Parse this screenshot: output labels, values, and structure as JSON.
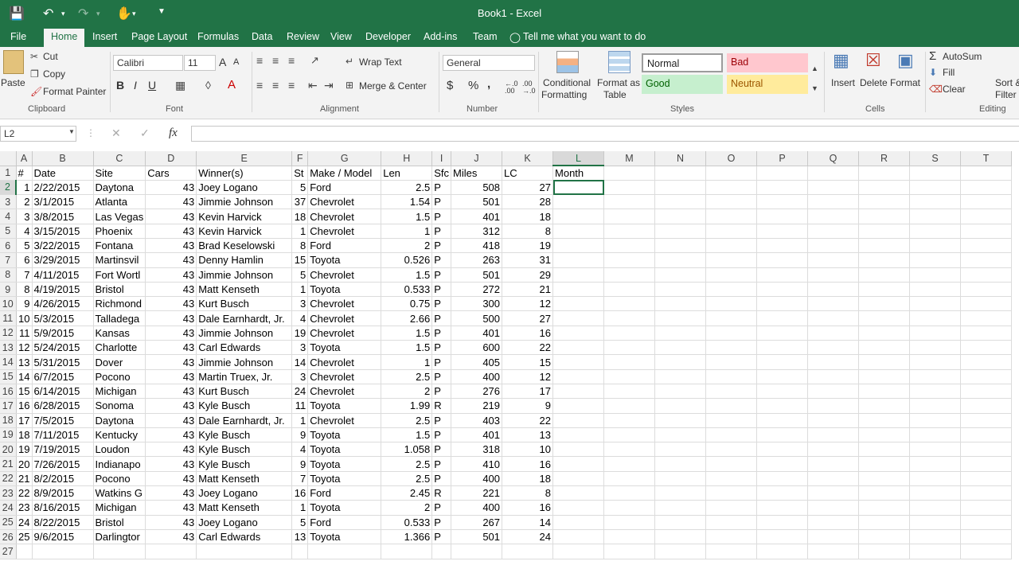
{
  "window": {
    "title": "Book1 - Excel"
  },
  "tabs": [
    "File",
    "Home",
    "Insert",
    "Page Layout",
    "Formulas",
    "Data",
    "Review",
    "View",
    "Developer",
    "Add-ins",
    "Team"
  ],
  "tell_me": "Tell me what you want to do",
  "ribbon": {
    "clipboard": {
      "paste": "Paste",
      "cut": "Cut",
      "copy": "Copy",
      "format_painter": "Format Painter",
      "label": "Clipboard"
    },
    "font": {
      "family": "Calibri",
      "size": "11",
      "label": "Font",
      "bold": "B",
      "italic": "I",
      "underline": "U",
      "grow": "A",
      "shrink": "A"
    },
    "alignment": {
      "wrap": "Wrap Text",
      "merge": "Merge & Center",
      "label": "Alignment"
    },
    "number": {
      "format": "General",
      "currency": "$",
      "percent": "%",
      "comma": ",",
      "label": "Number",
      "inc_dec": "←.0 .00",
      "dec_dec": ".00 →.0"
    },
    "styles": {
      "conditional_1": "Conditional",
      "conditional_2": "Formatting",
      "format_as_1": "Format as",
      "format_as_2": "Table",
      "normal": "Normal",
      "bad": "Bad",
      "good": "Good",
      "neutral": "Neutral",
      "label": "Styles",
      "colors": {
        "normal_bg": "#ffffff",
        "bad_bg": "#ffc7ce",
        "bad_fg": "#9c0006",
        "good_bg": "#c6efce",
        "good_fg": "#006100",
        "neutral_bg": "#ffeb9c",
        "neutral_fg": "#9c5700"
      }
    },
    "cells": {
      "insert": "Insert",
      "delete": "Delete",
      "format": "Format",
      "label": "Cells"
    },
    "editing": {
      "autosum": "AutoSum",
      "fill": "Fill",
      "clear": "Clear",
      "sort_1": "Sort &",
      "sort_2": "Filter",
      "label": "Editing"
    }
  },
  "formula_bar": {
    "name_box": "L2",
    "fx": "fx",
    "value": ""
  },
  "accent": "#217346",
  "columns": [
    "A",
    "B",
    "C",
    "D",
    "E",
    "F",
    "G",
    "H",
    "I",
    "J",
    "K",
    "L",
    "M",
    "N",
    "O",
    "P",
    "Q",
    "R",
    "S",
    "T"
  ],
  "headers": [
    "#",
    "Date",
    "Site",
    "Cars",
    "Winner(s)",
    "St",
    "Make / Model",
    "Len",
    "Sfc",
    "Miles",
    "LC",
    "Month"
  ],
  "rows": [
    [
      "1",
      "2/22/2015",
      "Daytona",
      "43",
      "Joey Logano",
      "5",
      "Ford",
      "2.5",
      "P",
      "508",
      "27"
    ],
    [
      "2",
      "3/1/2015",
      "Atlanta",
      "43",
      "Jimmie Johnson",
      "37",
      "Chevrolet",
      "1.54",
      "P",
      "501",
      "28"
    ],
    [
      "3",
      "3/8/2015",
      "Las Vegas",
      "43",
      "Kevin Harvick",
      "18",
      "Chevrolet",
      "1.5",
      "P",
      "401",
      "18"
    ],
    [
      "4",
      "3/15/2015",
      "Phoenix",
      "43",
      "Kevin Harvick",
      "1",
      "Chevrolet",
      "1",
      "P",
      "312",
      "8"
    ],
    [
      "5",
      "3/22/2015",
      "Fontana",
      "43",
      "Brad Keselowski",
      "8",
      "Ford",
      "2",
      "P",
      "418",
      "19"
    ],
    [
      "6",
      "3/29/2015",
      "Martinsvil",
      "43",
      "Denny Hamlin",
      "15",
      "Toyota",
      "0.526",
      "P",
      "263",
      "31"
    ],
    [
      "7",
      "4/11/2015",
      "Fort Wortl",
      "43",
      "Jimmie Johnson",
      "5",
      "Chevrolet",
      "1.5",
      "P",
      "501",
      "29"
    ],
    [
      "8",
      "4/19/2015",
      "Bristol",
      "43",
      "Matt Kenseth",
      "1",
      "Toyota",
      "0.533",
      "P",
      "272",
      "21"
    ],
    [
      "9",
      "4/26/2015",
      "Richmond",
      "43",
      "Kurt Busch",
      "3",
      "Chevrolet",
      "0.75",
      "P",
      "300",
      "12"
    ],
    [
      "10",
      "5/3/2015",
      "Talladega",
      "43",
      "Dale Earnhardt, Jr.",
      "4",
      "Chevrolet",
      "2.66",
      "P",
      "500",
      "27"
    ],
    [
      "11",
      "5/9/2015",
      "Kansas",
      "43",
      "Jimmie Johnson",
      "19",
      "Chevrolet",
      "1.5",
      "P",
      "401",
      "16"
    ],
    [
      "12",
      "5/24/2015",
      "Charlotte",
      "43",
      "Carl Edwards",
      "3",
      "Toyota",
      "1.5",
      "P",
      "600",
      "22"
    ],
    [
      "13",
      "5/31/2015",
      "Dover",
      "43",
      "Jimmie Johnson",
      "14",
      "Chevrolet",
      "1",
      "P",
      "405",
      "15"
    ],
    [
      "14",
      "6/7/2015",
      "Pocono",
      "43",
      "Martin Truex, Jr.",
      "3",
      "Chevrolet",
      "2.5",
      "P",
      "400",
      "12"
    ],
    [
      "15",
      "6/14/2015",
      "Michigan",
      "43",
      "Kurt Busch",
      "24",
      "Chevrolet",
      "2",
      "P",
      "276",
      "17"
    ],
    [
      "16",
      "6/28/2015",
      "Sonoma",
      "43",
      "Kyle Busch",
      "11",
      "Toyota",
      "1.99",
      "R",
      "219",
      "9"
    ],
    [
      "17",
      "7/5/2015",
      "Daytona",
      "43",
      "Dale Earnhardt, Jr.",
      "1",
      "Chevrolet",
      "2.5",
      "P",
      "403",
      "22"
    ],
    [
      "18",
      "7/11/2015",
      "Kentucky",
      "43",
      "Kyle Busch",
      "9",
      "Toyota",
      "1.5",
      "P",
      "401",
      "13"
    ],
    [
      "19",
      "7/19/2015",
      "Loudon",
      "43",
      "Kyle Busch",
      "4",
      "Toyota",
      "1.058",
      "P",
      "318",
      "10"
    ],
    [
      "20",
      "7/26/2015",
      "Indianapo",
      "43",
      "Kyle Busch",
      "9",
      "Toyota",
      "2.5",
      "P",
      "410",
      "16"
    ],
    [
      "21",
      "8/2/2015",
      "Pocono",
      "43",
      "Matt Kenseth",
      "7",
      "Toyota",
      "2.5",
      "P",
      "400",
      "18"
    ],
    [
      "22",
      "8/9/2015",
      "Watkins G",
      "43",
      "Joey Logano",
      "16",
      "Ford",
      "2.45",
      "R",
      "221",
      "8"
    ],
    [
      "23",
      "8/16/2015",
      "Michigan",
      "43",
      "Matt Kenseth",
      "1",
      "Toyota",
      "2",
      "P",
      "400",
      "16"
    ],
    [
      "24",
      "8/22/2015",
      "Bristol",
      "43",
      "Joey Logano",
      "5",
      "Ford",
      "0.533",
      "P",
      "267",
      "14"
    ],
    [
      "25",
      "9/6/2015",
      "Darlingtor",
      "43",
      "Carl Edwards",
      "13",
      "Toyota",
      "1.366",
      "P",
      "501",
      "24"
    ]
  ]
}
